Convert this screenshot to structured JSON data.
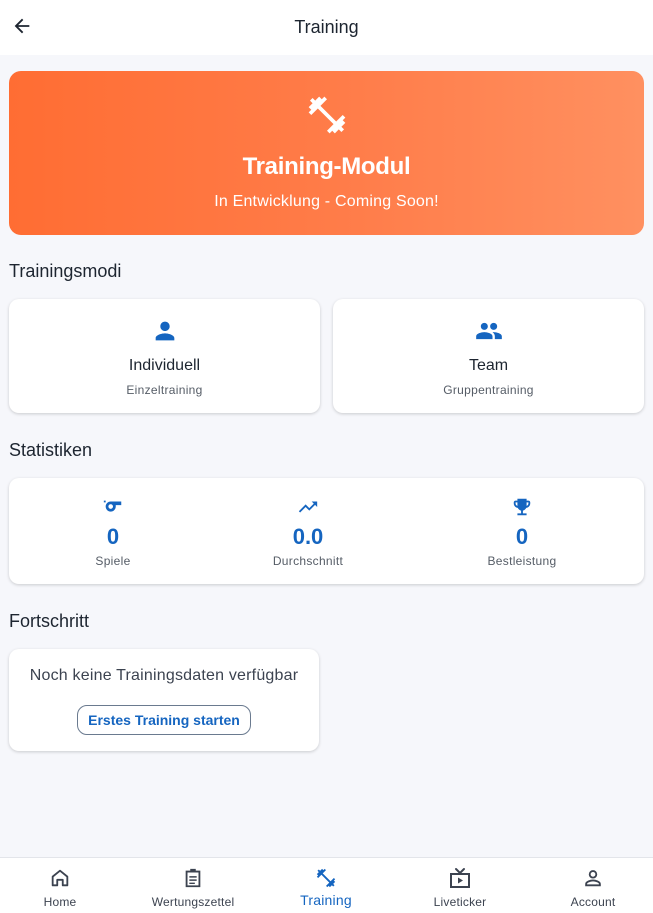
{
  "appbar": {
    "title": "Training",
    "back_icon": "arrow-back-icon"
  },
  "hero": {
    "icon": "dumbbell-icon",
    "title": "Training-Modul",
    "subtitle": "In Entwicklung - Coming Soon!",
    "gradient_start": "#ff6d33",
    "gradient_end": "#ff9060"
  },
  "modes": {
    "section_title": "Trainingsmodi",
    "items": [
      {
        "icon": "person-icon",
        "title": "Individuell",
        "subtitle": "Einzeltraining"
      },
      {
        "icon": "group-icon",
        "title": "Team",
        "subtitle": "Gruppentraining"
      }
    ]
  },
  "stats": {
    "section_title": "Statistiken",
    "items": [
      {
        "icon": "whistle-icon",
        "value": "0",
        "label": "Spiele"
      },
      {
        "icon": "trending-up-icon",
        "value": "0.0",
        "label": "Durchschnitt"
      },
      {
        "icon": "trophy-icon",
        "value": "0",
        "label": "Bestleistung"
      }
    ]
  },
  "progress": {
    "section_title": "Fortschritt",
    "empty_message": "Noch keine Trainingsdaten verfügbar",
    "start_button": "Erstes Training starten"
  },
  "nav": {
    "items": [
      {
        "icon": "home-icon",
        "label": "Home",
        "active": false
      },
      {
        "icon": "clipboard-icon",
        "label": "Wertungszettel",
        "active": false
      },
      {
        "icon": "dumbbell-icon",
        "label": "Training",
        "active": true
      },
      {
        "icon": "live-tv-icon",
        "label": "Liveticker",
        "active": false
      },
      {
        "icon": "account-icon",
        "label": "Account",
        "active": false
      }
    ]
  },
  "colors": {
    "accent": "#1565c0",
    "background": "#f6f7fb",
    "text": "#1d2530"
  }
}
